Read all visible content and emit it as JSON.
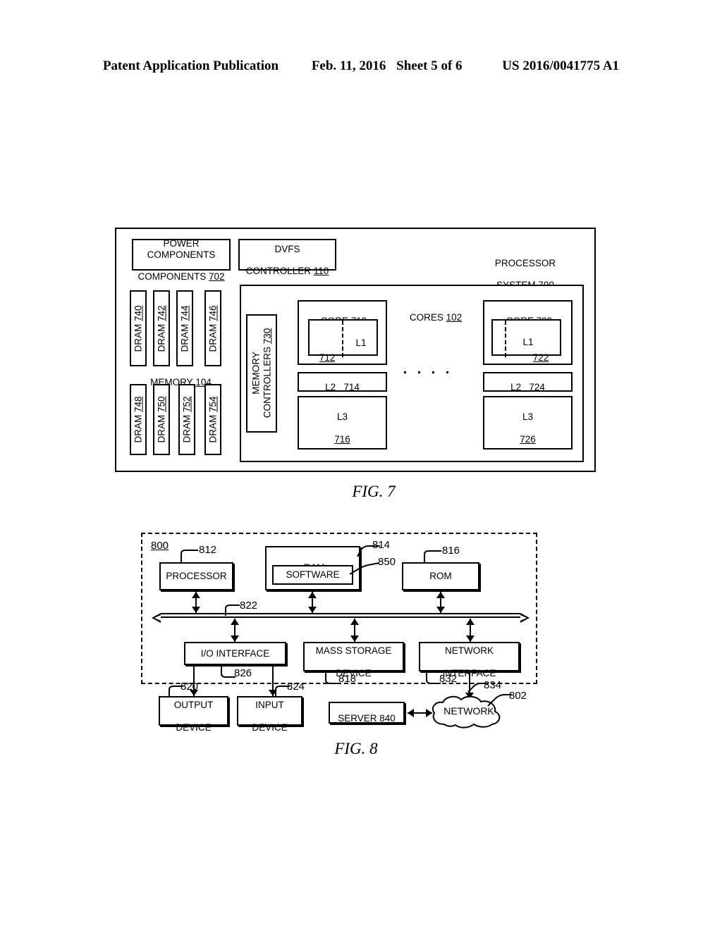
{
  "header": {
    "publication": "Patent Application Publication",
    "date": "Feb. 11, 2016",
    "sheet": "Sheet 5 of 6",
    "patent_number": "US 2016/0041775 A1"
  },
  "fig7": {
    "caption": "FIG. 7",
    "system_label": "PROCESSOR\nSYSTEM 700",
    "system_label_text": "PROCESSOR SYSTEM",
    "system_ref": "700",
    "power_components": "POWER\nCOMPONENTS 702",
    "power_components_text": "POWER COMPONENTS",
    "power_components_ref": "702",
    "dvfs_controller": "DVFS\nCONTROLLER 110",
    "dvfs_controller_text": "DVFS CONTROLLER",
    "dvfs_controller_ref": "110",
    "memory_label_text": "MEMORY",
    "memory_label_ref": "104",
    "dram_top": [
      {
        "text": "DRAM",
        "ref": "740"
      },
      {
        "text": "DRAM",
        "ref": "742"
      },
      {
        "text": "DRAM",
        "ref": "744"
      },
      {
        "text": "DRAM",
        "ref": "746"
      }
    ],
    "dram_bottom": [
      {
        "text": "DRAM",
        "ref": "748"
      },
      {
        "text": "DRAM",
        "ref": "750"
      },
      {
        "text": "DRAM",
        "ref": "752"
      },
      {
        "text": "DRAM",
        "ref": "754"
      }
    ],
    "memory_controllers_text": "MEMORY CONTROLLERS",
    "memory_controllers_ref": "730",
    "cores_label_text": "CORES",
    "cores_label_ref": "102",
    "core_left": {
      "title_text": "CORE",
      "title_ref": "710",
      "l1_label": "L1",
      "l1_ref": "712",
      "l2_label": "L2",
      "l2_ref": "714",
      "l3_label": "L3",
      "l3_ref": "716"
    },
    "core_right": {
      "title_text": "CORE",
      "title_ref": "720",
      "l1_label": "L1",
      "l1_ref": "722",
      "l2_label": "L2",
      "l2_ref": "724",
      "l3_label": "L3",
      "l3_ref": "726"
    }
  },
  "fig8": {
    "caption": "FIG. 8",
    "system_ref": "800",
    "processor": {
      "label": "PROCESSOR",
      "ref": "812"
    },
    "ram": {
      "label": "RAM",
      "ref": "814"
    },
    "software": {
      "label": "SOFTWARE",
      "ref": "850"
    },
    "rom": {
      "label": "ROM",
      "ref": "816"
    },
    "bus": {
      "ref": "822"
    },
    "io_interface": {
      "label": "I/O INTERFACE",
      "ref": "826"
    },
    "mass_storage": {
      "label": "MASS STORAGE\nDEVICE",
      "ref": "818"
    },
    "network_interface": {
      "label": "NETWORK\nINTERFACE",
      "ref": "832"
    },
    "output_device": {
      "label": "OUTPUT\nDEVICE",
      "ref": "820"
    },
    "input_device": {
      "label": "INPUT\nDEVICE",
      "ref": "824"
    },
    "server": {
      "text": "SERVER",
      "ref": "840"
    },
    "network": {
      "label": "NETWORK",
      "ref": "802",
      "link_ref": "834"
    }
  }
}
